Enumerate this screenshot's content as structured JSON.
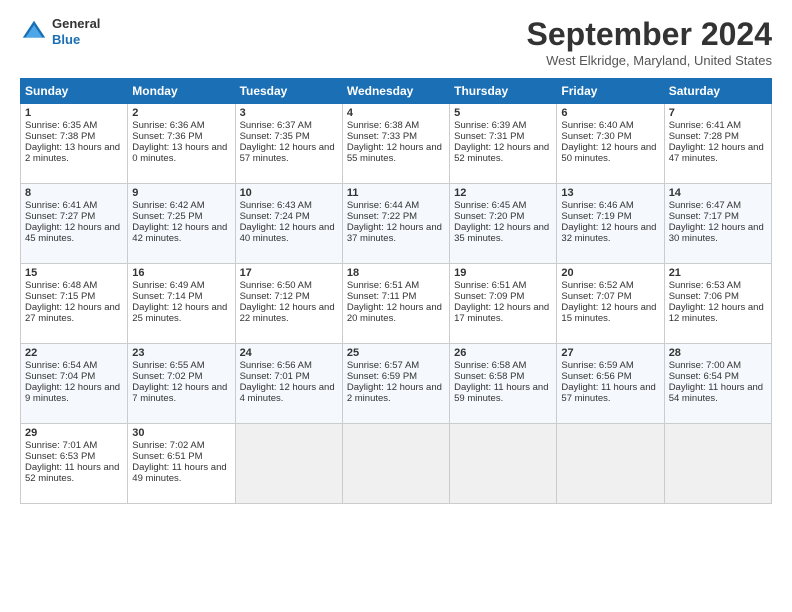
{
  "logo": {
    "line1": "General",
    "line2": "Blue"
  },
  "title": "September 2024",
  "location": "West Elkridge, Maryland, United States",
  "days_header": [
    "Sunday",
    "Monday",
    "Tuesday",
    "Wednesday",
    "Thursday",
    "Friday",
    "Saturday"
  ],
  "weeks": [
    [
      {
        "day": "1",
        "sunrise": "6:35 AM",
        "sunset": "7:38 PM",
        "daylight": "13 hours and 2 minutes."
      },
      {
        "day": "2",
        "sunrise": "6:36 AM",
        "sunset": "7:36 PM",
        "daylight": "13 hours and 0 minutes."
      },
      {
        "day": "3",
        "sunrise": "6:37 AM",
        "sunset": "7:35 PM",
        "daylight": "12 hours and 57 minutes."
      },
      {
        "day": "4",
        "sunrise": "6:38 AM",
        "sunset": "7:33 PM",
        "daylight": "12 hours and 55 minutes."
      },
      {
        "day": "5",
        "sunrise": "6:39 AM",
        "sunset": "7:31 PM",
        "daylight": "12 hours and 52 minutes."
      },
      {
        "day": "6",
        "sunrise": "6:40 AM",
        "sunset": "7:30 PM",
        "daylight": "12 hours and 50 minutes."
      },
      {
        "day": "7",
        "sunrise": "6:41 AM",
        "sunset": "7:28 PM",
        "daylight": "12 hours and 47 minutes."
      }
    ],
    [
      {
        "day": "8",
        "sunrise": "6:41 AM",
        "sunset": "7:27 PM",
        "daylight": "12 hours and 45 minutes."
      },
      {
        "day": "9",
        "sunrise": "6:42 AM",
        "sunset": "7:25 PM",
        "daylight": "12 hours and 42 minutes."
      },
      {
        "day": "10",
        "sunrise": "6:43 AM",
        "sunset": "7:24 PM",
        "daylight": "12 hours and 40 minutes."
      },
      {
        "day": "11",
        "sunrise": "6:44 AM",
        "sunset": "7:22 PM",
        "daylight": "12 hours and 37 minutes."
      },
      {
        "day": "12",
        "sunrise": "6:45 AM",
        "sunset": "7:20 PM",
        "daylight": "12 hours and 35 minutes."
      },
      {
        "day": "13",
        "sunrise": "6:46 AM",
        "sunset": "7:19 PM",
        "daylight": "12 hours and 32 minutes."
      },
      {
        "day": "14",
        "sunrise": "6:47 AM",
        "sunset": "7:17 PM",
        "daylight": "12 hours and 30 minutes."
      }
    ],
    [
      {
        "day": "15",
        "sunrise": "6:48 AM",
        "sunset": "7:15 PM",
        "daylight": "12 hours and 27 minutes."
      },
      {
        "day": "16",
        "sunrise": "6:49 AM",
        "sunset": "7:14 PM",
        "daylight": "12 hours and 25 minutes."
      },
      {
        "day": "17",
        "sunrise": "6:50 AM",
        "sunset": "7:12 PM",
        "daylight": "12 hours and 22 minutes."
      },
      {
        "day": "18",
        "sunrise": "6:51 AM",
        "sunset": "7:11 PM",
        "daylight": "12 hours and 20 minutes."
      },
      {
        "day": "19",
        "sunrise": "6:51 AM",
        "sunset": "7:09 PM",
        "daylight": "12 hours and 17 minutes."
      },
      {
        "day": "20",
        "sunrise": "6:52 AM",
        "sunset": "7:07 PM",
        "daylight": "12 hours and 15 minutes."
      },
      {
        "day": "21",
        "sunrise": "6:53 AM",
        "sunset": "7:06 PM",
        "daylight": "12 hours and 12 minutes."
      }
    ],
    [
      {
        "day": "22",
        "sunrise": "6:54 AM",
        "sunset": "7:04 PM",
        "daylight": "12 hours and 9 minutes."
      },
      {
        "day": "23",
        "sunrise": "6:55 AM",
        "sunset": "7:02 PM",
        "daylight": "12 hours and 7 minutes."
      },
      {
        "day": "24",
        "sunrise": "6:56 AM",
        "sunset": "7:01 PM",
        "daylight": "12 hours and 4 minutes."
      },
      {
        "day": "25",
        "sunrise": "6:57 AM",
        "sunset": "6:59 PM",
        "daylight": "12 hours and 2 minutes."
      },
      {
        "day": "26",
        "sunrise": "6:58 AM",
        "sunset": "6:58 PM",
        "daylight": "11 hours and 59 minutes."
      },
      {
        "day": "27",
        "sunrise": "6:59 AM",
        "sunset": "6:56 PM",
        "daylight": "11 hours and 57 minutes."
      },
      {
        "day": "28",
        "sunrise": "7:00 AM",
        "sunset": "6:54 PM",
        "daylight": "11 hours and 54 minutes."
      }
    ],
    [
      {
        "day": "29",
        "sunrise": "7:01 AM",
        "sunset": "6:53 PM",
        "daylight": "11 hours and 52 minutes."
      },
      {
        "day": "30",
        "sunrise": "7:02 AM",
        "sunset": "6:51 PM",
        "daylight": "11 hours and 49 minutes."
      },
      null,
      null,
      null,
      null,
      null
    ]
  ]
}
